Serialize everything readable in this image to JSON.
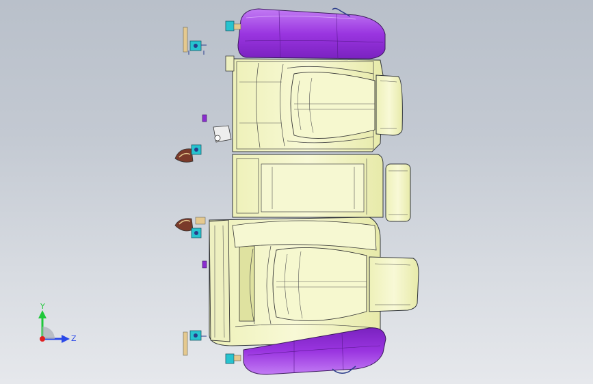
{
  "viewport": {
    "background_top": "#b9c0ca",
    "background_bottom": "#e6e8ec"
  },
  "colors": {
    "cushion_fill": "#f4f6c4",
    "cushion_fill_dark": "#e8ebb0",
    "edge_stroke": "#30343a",
    "bolster_purple": "#8a2ccf",
    "bolster_purple_light": "#b45cf0",
    "bracket_cyan": "#27c3cf",
    "bracket_tan": "#e5c98f",
    "hinge_brown": "#7a3a2a",
    "wire_blue": "#2a3c8a"
  },
  "triad": {
    "y_label": "Y",
    "z_label": "Z",
    "y_color": "#1fc83a",
    "z_color": "#2a48e8",
    "x_color": "#e02020"
  }
}
